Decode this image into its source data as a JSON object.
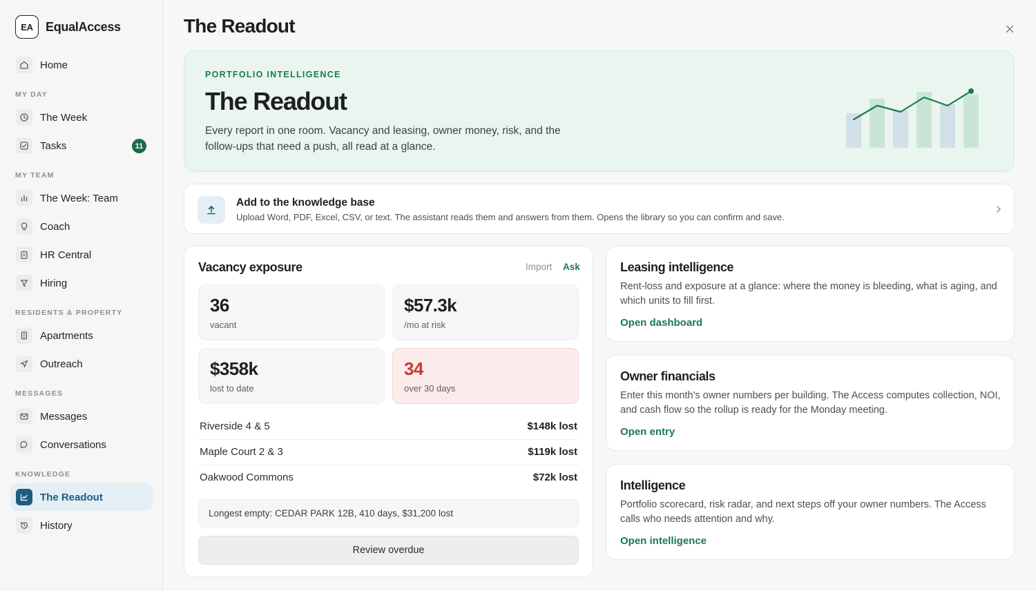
{
  "app": {
    "logo_initials": "EA",
    "name": "EqualAccess"
  },
  "sidebar": {
    "home": "Home",
    "sections": {
      "my_day": "MY DAY",
      "my_team": "MY TEAM",
      "residents": "RESIDENTS & PROPERTY",
      "messages": "MESSAGES",
      "knowledge": "KNOWLEDGE"
    },
    "items": {
      "the_week": "The Week",
      "tasks": "Tasks",
      "tasks_badge": "11",
      "week_team": "The Week: Team",
      "coach": "Coach",
      "hr_central": "HR Central",
      "hiring": "Hiring",
      "apartments": "Apartments",
      "outreach": "Outreach",
      "messages": "Messages",
      "conversations": "Conversations",
      "the_readout": "The Readout",
      "history": "History"
    }
  },
  "page": {
    "title": "The Readout"
  },
  "hero": {
    "eyebrow": "PORTFOLIO INTELLIGENCE",
    "title": "The Readout",
    "description": "Every report in one room. Vacancy and leasing, owner money, risk, and the follow-ups that need a push, all read at a glance."
  },
  "knowledge_base": {
    "title": "Add to the knowledge base",
    "description": "Upload Word, PDF, Excel, CSV, or text. The assistant reads them and answers from them. Opens the library so you can confirm and save."
  },
  "vacancy": {
    "title": "Vacancy exposure",
    "import_label": "Import",
    "ask_label": "Ask",
    "stats": [
      {
        "value": "36",
        "label": "vacant"
      },
      {
        "value": "$57.3k",
        "label": "/mo at risk"
      },
      {
        "value": "$358k",
        "label": "lost to date"
      },
      {
        "value": "34",
        "label": "over 30 days"
      }
    ],
    "rows": [
      {
        "name": "Riverside 4 & 5",
        "amount": "$148k lost"
      },
      {
        "name": "Maple Court 2 & 3",
        "amount": "$119k lost"
      },
      {
        "name": "Oakwood Commons",
        "amount": "$72k lost"
      }
    ],
    "longest_empty": "Longest empty: CEDAR PARK 12B, 410 days, $31,200 lost",
    "review_button": "Review overdue"
  },
  "cards": [
    {
      "title": "Leasing intelligence",
      "description": "Rent-loss and exposure at a glance: where the money is bleeding, what is aging, and which units to fill first.",
      "link": "Open dashboard"
    },
    {
      "title": "Owner financials",
      "description": "Enter this month's owner numbers per building. The Access computes collection, NOI, and cash flow so the rollup is ready for the Monday meeting.",
      "link": "Open entry"
    },
    {
      "title": "Intelligence",
      "description": "Portfolio scorecard, risk radar, and next steps off your owner numbers. The Access calls who needs attention and why.",
      "link": "Open intelligence"
    }
  ],
  "colors": {
    "accent_green": "#1b7a4f",
    "accent_blue": "#1c5d7e",
    "alert_red": "#c93a2d",
    "hero_bg": "#eaf5ef"
  },
  "icons": {
    "home": "home-icon",
    "week": "clock-icon",
    "tasks": "checkbox-icon",
    "team": "bar-chart-icon",
    "coach": "lightbulb-icon",
    "hr": "clipboard-icon",
    "hiring": "funnel-icon",
    "apartments": "building-icon",
    "outreach": "send-icon",
    "messages": "mail-icon",
    "conversations": "chat-bubble-icon",
    "readout": "line-chart-icon",
    "history": "history-icon",
    "upload": "upload-icon",
    "close": "close-icon",
    "chevron": "chevron-right-icon"
  }
}
